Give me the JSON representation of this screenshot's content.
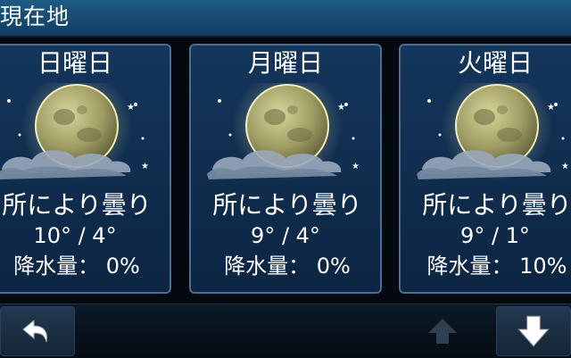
{
  "header": {
    "title": "現在地"
  },
  "days": [
    {
      "day": "日曜日",
      "condition": "所により曇り",
      "temp": "10° / 4°",
      "precip_label": "降水量：",
      "precip_value": "0%"
    },
    {
      "day": "月曜日",
      "condition": "所により曇り",
      "temp": "9° / 4°",
      "precip_label": "降水量：",
      "precip_value": "0%"
    },
    {
      "day": "火曜日",
      "condition": "所により曇り",
      "temp": "9° / 1°",
      "precip_label": "降水量：",
      "precip_value": "10%"
    }
  ],
  "footer": {
    "back_icon": "back-arrow-icon",
    "up_icon": "arrow-up-icon",
    "down_icon": "arrow-down-icon"
  },
  "colors": {
    "title_bar": "#1a4f76",
    "card_bg": "#123256",
    "card_border": "#4a6d90",
    "moon": "#a9a66f"
  }
}
